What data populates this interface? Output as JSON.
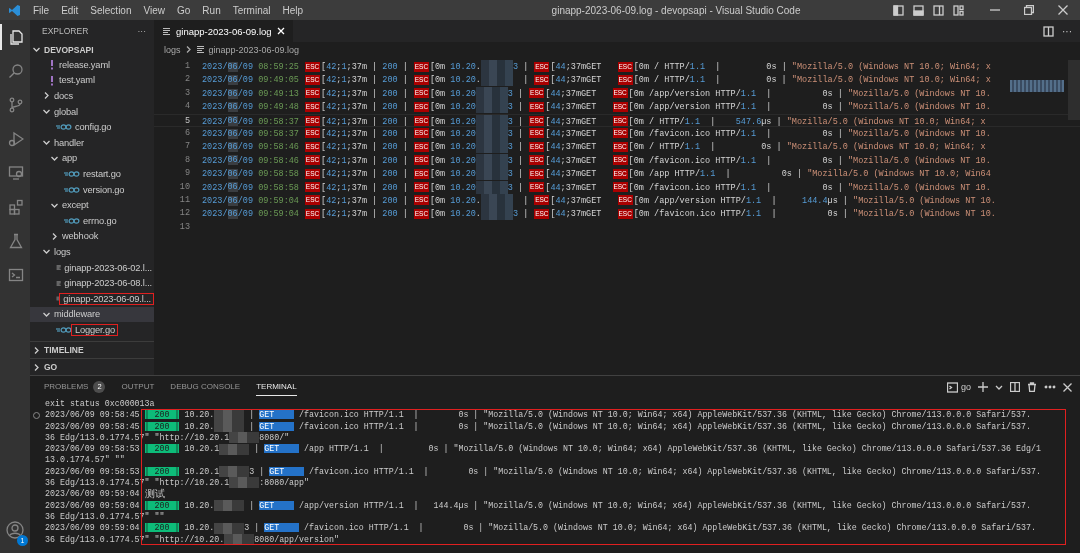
{
  "window": {
    "title": "ginapp-2023-06-09.log - devopsapi - Visual Studio Code"
  },
  "menu": [
    "File",
    "Edit",
    "Selection",
    "View",
    "Go",
    "Run",
    "Terminal",
    "Help"
  ],
  "activity_bar": [
    {
      "kind": "explorer",
      "selected": true
    },
    {
      "kind": "search",
      "selected": false
    },
    {
      "kind": "source-control",
      "selected": false
    },
    {
      "kind": "run",
      "selected": false
    },
    {
      "kind": "remote",
      "selected": false
    },
    {
      "kind": "extensions",
      "selected": false
    },
    {
      "kind": "testing",
      "selected": false
    },
    {
      "kind": "terminal",
      "selected": false
    }
  ],
  "account": {
    "badge": "1"
  },
  "sidebar": {
    "title": "EXPLORER",
    "more": "···",
    "project": {
      "label": "DEVOPSAPI",
      "expanded": true
    },
    "items": [
      {
        "label": "release.yaml",
        "kind": "yaml",
        "selected": false,
        "highlighted": false
      },
      {
        "label": "test.yaml",
        "kind": "yaml",
        "selected": false,
        "highlighted": false
      },
      {
        "label": "docs",
        "kind": "folder",
        "expanded": false,
        "selected": false,
        "highlighted": false
      },
      {
        "label": "global",
        "kind": "folder",
        "expanded": true,
        "selected": false,
        "highlighted": false,
        "children": [
          {
            "label": "config.go",
            "kind": "go",
            "selected": false,
            "highlighted": false
          }
        ]
      },
      {
        "label": "handler",
        "kind": "folder",
        "expanded": true,
        "selected": false,
        "highlighted": false,
        "children": [
          {
            "label": "app",
            "kind": "folder",
            "expanded": true,
            "selected": false,
            "highlighted": false,
            "children": [
              {
                "label": "restart.go",
                "kind": "go",
                "selected": false,
                "highlighted": false
              },
              {
                "label": "version.go",
                "kind": "go",
                "selected": false,
                "highlighted": false
              }
            ]
          },
          {
            "label": "except",
            "kind": "folder",
            "expanded": true,
            "selected": false,
            "highlighted": false,
            "children": [
              {
                "label": "errno.go",
                "kind": "go",
                "selected": false,
                "highlighted": false
              }
            ]
          },
          {
            "label": "webhook",
            "kind": "folder",
            "expanded": false,
            "selected": false,
            "highlighted": false
          }
        ]
      },
      {
        "label": "logs",
        "kind": "folder",
        "expanded": true,
        "selected": false,
        "highlighted": false,
        "children": [
          {
            "label": "ginapp-2023-06-02.l...",
            "kind": "log",
            "selected": false,
            "highlighted": false
          },
          {
            "label": "ginapp-2023-06-08.l...",
            "kind": "log",
            "selected": false,
            "highlighted": false
          },
          {
            "label": "ginapp-2023-06-09.l...",
            "kind": "log",
            "selected": false,
            "highlighted": true
          }
        ]
      },
      {
        "label": "middleware",
        "kind": "folder",
        "expanded": true,
        "selected": true,
        "highlighted": false,
        "children": [
          {
            "label": "Logger.go",
            "kind": "go",
            "selected": false,
            "highlighted": true
          }
        ]
      }
    ],
    "sections": [
      {
        "label": "TIMELINE",
        "expanded": false
      },
      {
        "label": "GO",
        "expanded": false
      }
    ]
  },
  "editor": {
    "tabs": [
      {
        "label": "ginapp-2023-06-09.log",
        "selected": true
      }
    ],
    "breadcrumb": [
      "logs",
      "ginapp-2023-06-09.log"
    ],
    "more": "···",
    "lines": [
      {
        "number": "1",
        "current": false,
        "segments": [
          {
            "kind": "date",
            "text": "2023/"
          },
          {
            "kind": "match",
            "text": "06"
          },
          {
            "kind": "date",
            "text": "/09"
          },
          {
            "kind": "time",
            "text": " 08:59:25 "
          },
          {
            "kind": "esc",
            "text": "ESC"
          },
          {
            "kind": "code",
            "text": "[42;1;37m | 200 | "
          },
          {
            "kind": "esc",
            "text": "ESC"
          },
          {
            "kind": "code",
            "text": "[0m 10.20."
          },
          {
            "kind": "blur"
          },
          {
            "kind": "code",
            "text": "3 | "
          },
          {
            "kind": "esc",
            "text": "ESC"
          },
          {
            "kind": "code",
            "text": "[44;37mGET   "
          },
          {
            "kind": "esc",
            "text": "ESC"
          },
          {
            "kind": "code",
            "text": "[0m / HTTP/1.1  |         0s | \"Mozilla/5.0 (Windows NT 10.0; Win64; x"
          }
        ]
      },
      {
        "number": "2",
        "current": false,
        "segments": [
          {
            "kind": "date",
            "text": "2023/"
          },
          {
            "kind": "match",
            "text": "06"
          },
          {
            "kind": "date",
            "text": "/09"
          },
          {
            "kind": "time",
            "text": " 09:49:05 "
          },
          {
            "kind": "esc",
            "text": "ESC"
          },
          {
            "kind": "code",
            "text": "[42;1;37m | 200 | "
          },
          {
            "kind": "esc",
            "text": "ESC"
          },
          {
            "kind": "code",
            "text": "[0m 10.20."
          },
          {
            "kind": "blur"
          },
          {
            "kind": "code",
            "text": "  | "
          },
          {
            "kind": "esc",
            "text": "ESC"
          },
          {
            "kind": "code",
            "text": "[44;37mGET   "
          },
          {
            "kind": "esc",
            "text": "ESC"
          },
          {
            "kind": "code",
            "text": "[0m / HTTP/1.1  |         0s | \"Mozilla/5.0 (Windows NT 10.0; Win64; x"
          }
        ]
      },
      {
        "number": "3",
        "current": false,
        "segments": [
          {
            "kind": "date",
            "text": "2023/"
          },
          {
            "kind": "match",
            "text": "06"
          },
          {
            "kind": "date",
            "text": "/09"
          },
          {
            "kind": "time",
            "text": " 09:49:13 "
          },
          {
            "kind": "esc",
            "text": "ESC"
          },
          {
            "kind": "code",
            "text": "[42;1;37m | 200 | "
          },
          {
            "kind": "esc",
            "text": "ESC"
          },
          {
            "kind": "code",
            "text": "[0m 10.20"
          },
          {
            "kind": "blur"
          },
          {
            "kind": "code",
            "text": "3 | "
          },
          {
            "kind": "esc",
            "text": "ESC"
          },
          {
            "kind": "code",
            "text": "[44;37mGET   "
          },
          {
            "kind": "esc",
            "text": "ESC"
          },
          {
            "kind": "code",
            "text": "[0m /app/version HTTP/1.1  |          0s | \"Mozilla/5.0 (Windows NT 10."
          }
        ]
      },
      {
        "number": "4",
        "current": false,
        "segments": [
          {
            "kind": "date",
            "text": "2023/"
          },
          {
            "kind": "match",
            "text": "06"
          },
          {
            "kind": "date",
            "text": "/09"
          },
          {
            "kind": "time",
            "text": " 09:49:48 "
          },
          {
            "kind": "esc",
            "text": "ESC"
          },
          {
            "kind": "code",
            "text": "[42;1;37m | 200 | "
          },
          {
            "kind": "esc",
            "text": "ESC"
          },
          {
            "kind": "code",
            "text": "[0m 10.20"
          },
          {
            "kind": "blur"
          },
          {
            "kind": "code",
            "text": "3 | "
          },
          {
            "kind": "esc",
            "text": "ESC"
          },
          {
            "kind": "code",
            "text": "[44;37mGET   "
          },
          {
            "kind": "esc",
            "text": "ESC"
          },
          {
            "kind": "code",
            "text": "[0m /app/version HTTP/1.1  |          0s | \"Mozilla/5.0 (Windows NT 10."
          }
        ]
      },
      {
        "number": "5",
        "current": true,
        "segments": [
          {
            "kind": "date",
            "text": "2023/"
          },
          {
            "kind": "match",
            "text": "06"
          },
          {
            "kind": "date",
            "text": "/09"
          },
          {
            "kind": "time",
            "text": " 09:58:37 "
          },
          {
            "kind": "esc",
            "text": "ESC"
          },
          {
            "kind": "code",
            "text": "[42;1;37m | 200 | "
          },
          {
            "kind": "esc",
            "text": "ESC"
          },
          {
            "kind": "code",
            "text": "[0m 10.20"
          },
          {
            "kind": "blur"
          },
          {
            "kind": "code",
            "text": "3 | "
          },
          {
            "kind": "esc",
            "text": "ESC"
          },
          {
            "kind": "code",
            "text": "[44;37mGET   "
          },
          {
            "kind": "esc",
            "text": "ESC"
          },
          {
            "kind": "code",
            "text": "[0m / HTTP/1.1  |    547.6µs | \"Mozilla/5.0 (Windows NT 10.0; Win64; x"
          }
        ]
      },
      {
        "number": "6",
        "current": false,
        "segments": [
          {
            "kind": "date",
            "text": "2023/"
          },
          {
            "kind": "match",
            "text": "06"
          },
          {
            "kind": "date",
            "text": "/09"
          },
          {
            "kind": "time",
            "text": " 09:58:37 "
          },
          {
            "kind": "esc",
            "text": "ESC"
          },
          {
            "kind": "code",
            "text": "[42;1;37m | 200 | "
          },
          {
            "kind": "esc",
            "text": "ESC"
          },
          {
            "kind": "code",
            "text": "[0m 10.20"
          },
          {
            "kind": "blur"
          },
          {
            "kind": "code",
            "text": "3 | "
          },
          {
            "kind": "esc",
            "text": "ESC"
          },
          {
            "kind": "code",
            "text": "[44;37mGET   "
          },
          {
            "kind": "esc",
            "text": "ESC"
          },
          {
            "kind": "code",
            "text": "[0m /favicon.ico HTTP/1.1  |          0s | \"Mozilla/5.0 (Windows NT 10."
          }
        ]
      },
      {
        "number": "7",
        "current": false,
        "segments": [
          {
            "kind": "date",
            "text": "2023/"
          },
          {
            "kind": "match",
            "text": "06"
          },
          {
            "kind": "date",
            "text": "/09"
          },
          {
            "kind": "time",
            "text": " 09:58:46 "
          },
          {
            "kind": "esc",
            "text": "ESC"
          },
          {
            "kind": "code",
            "text": "[42;1;37m | 200 | "
          },
          {
            "kind": "esc",
            "text": "ESC"
          },
          {
            "kind": "code",
            "text": "[0m 10.20"
          },
          {
            "kind": "blur"
          },
          {
            "kind": "code",
            "text": "3 | "
          },
          {
            "kind": "esc",
            "text": "ESC"
          },
          {
            "kind": "code",
            "text": "[44;37mGET   "
          },
          {
            "kind": "esc",
            "text": "ESC"
          },
          {
            "kind": "code",
            "text": "[0m / HTTP/1.1  |         0s | \"Mozilla/5.0 (Windows NT 10.0; Win64; x"
          }
        ]
      },
      {
        "number": "8",
        "current": false,
        "segments": [
          {
            "kind": "date",
            "text": "2023/"
          },
          {
            "kind": "match",
            "text": "06"
          },
          {
            "kind": "date",
            "text": "/09"
          },
          {
            "kind": "time",
            "text": " 09:58:46 "
          },
          {
            "kind": "esc",
            "text": "ESC"
          },
          {
            "kind": "code",
            "text": "[42;1;37m | 200 | "
          },
          {
            "kind": "esc",
            "text": "ESC"
          },
          {
            "kind": "code",
            "text": "[0m 10.20"
          },
          {
            "kind": "blur"
          },
          {
            "kind": "code",
            "text": "3 | "
          },
          {
            "kind": "esc",
            "text": "ESC"
          },
          {
            "kind": "code",
            "text": "[44;37mGET   "
          },
          {
            "kind": "esc",
            "text": "ESC"
          },
          {
            "kind": "code",
            "text": "[0m /favicon.ico HTTP/1.1  |          0s | \"Mozilla/5.0 (Windows NT 10."
          }
        ]
      },
      {
        "number": "9",
        "current": false,
        "segments": [
          {
            "kind": "date",
            "text": "2023/"
          },
          {
            "kind": "match",
            "text": "06"
          },
          {
            "kind": "date",
            "text": "/09"
          },
          {
            "kind": "time",
            "text": " 09:58:58 "
          },
          {
            "kind": "esc",
            "text": "ESC"
          },
          {
            "kind": "code",
            "text": "[42;1;37m | 200 | "
          },
          {
            "kind": "esc",
            "text": "ESC"
          },
          {
            "kind": "code",
            "text": "[0m 10.20"
          },
          {
            "kind": "blur"
          },
          {
            "kind": "code",
            "text": "3 | "
          },
          {
            "kind": "esc",
            "text": "ESC"
          },
          {
            "kind": "code",
            "text": "[44;37mGET   "
          },
          {
            "kind": "esc",
            "text": "ESC"
          },
          {
            "kind": "code",
            "text": "[0m /app HTTP/1.1  |          0s | \"Mozilla/5.0 (Windows NT 10.0; Win64"
          }
        ]
      },
      {
        "number": "10",
        "current": false,
        "segments": [
          {
            "kind": "date",
            "text": "2023/"
          },
          {
            "kind": "match",
            "text": "06"
          },
          {
            "kind": "date",
            "text": "/09"
          },
          {
            "kind": "time",
            "text": " 09:58:58 "
          },
          {
            "kind": "esc",
            "text": "ESC"
          },
          {
            "kind": "code",
            "text": "[42;1;37m | 200 | "
          },
          {
            "kind": "esc",
            "text": "ESC"
          },
          {
            "kind": "code",
            "text": "[0m 10.20"
          },
          {
            "kind": "blur"
          },
          {
            "kind": "code",
            "text": "3 | "
          },
          {
            "kind": "esc",
            "text": "ESC"
          },
          {
            "kind": "code",
            "text": "[44;37mGET   "
          },
          {
            "kind": "esc",
            "text": "ESC"
          },
          {
            "kind": "code",
            "text": "[0m /favicon.ico HTTP/1.1  |          0s | \"Mozilla/5.0 (Windows NT 10."
          }
        ]
      },
      {
        "number": "11",
        "current": false,
        "segments": [
          {
            "kind": "date",
            "text": "2023/"
          },
          {
            "kind": "match",
            "text": "06"
          },
          {
            "kind": "date",
            "text": "/09"
          },
          {
            "kind": "time",
            "text": " 09:59:04 "
          },
          {
            "kind": "esc",
            "text": "ESC"
          },
          {
            "kind": "code",
            "text": "[42;1;37m | 200 | "
          },
          {
            "kind": "esc",
            "text": "ESC"
          },
          {
            "kind": "code",
            "text": "[0m 10.20."
          },
          {
            "kind": "blur"
          },
          {
            "kind": "code",
            "text": "  | "
          },
          {
            "kind": "esc",
            "text": "ESC"
          },
          {
            "kind": "code",
            "text": "[44;37mGET   "
          },
          {
            "kind": "esc",
            "text": "ESC"
          },
          {
            "kind": "code",
            "text": "[0m /app/version HTTP/1.1  |     144.4µs | \"Mozilla/5.0 (Windows NT 10."
          }
        ]
      },
      {
        "number": "12",
        "current": false,
        "segments": [
          {
            "kind": "date",
            "text": "2023/"
          },
          {
            "kind": "match",
            "text": "06"
          },
          {
            "kind": "date",
            "text": "/09"
          },
          {
            "kind": "time",
            "text": " 09:59:04 "
          },
          {
            "kind": "esc",
            "text": "ESC"
          },
          {
            "kind": "code",
            "text": "[42;1;37m | 200 | "
          },
          {
            "kind": "esc",
            "text": "ESC"
          },
          {
            "kind": "code",
            "text": "[0m 10.20."
          },
          {
            "kind": "blur"
          },
          {
            "kind": "code",
            "text": "3 | "
          },
          {
            "kind": "esc",
            "text": "ESC"
          },
          {
            "kind": "code",
            "text": "[44;37mGET   "
          },
          {
            "kind": "esc",
            "text": "ESC"
          },
          {
            "kind": "code",
            "text": "[0m /favicon.ico HTTP/1.1  |          0s | \"Mozilla/5.0 (Windows NT 10."
          }
        ]
      },
      {
        "number": "13",
        "current": false
      }
    ]
  },
  "panel": {
    "tabs": [
      {
        "label": "PROBLEMS",
        "badge": "2",
        "selected": false
      },
      {
        "label": "OUTPUT",
        "selected": false
      },
      {
        "label": "DEBUG CONSOLE",
        "selected": false
      },
      {
        "label": "TERMINAL",
        "selected": true
      }
    ],
    "terminal_name": "go",
    "highlighted": true,
    "lines": [
      {
        "marker": false,
        "segments": [
          {
            "kind": "text",
            "text": "exit status 0xc000013a"
          }
        ]
      },
      {
        "marker": true,
        "segments": [
          {
            "kind": "text",
            "text": "2023/06/09 09:58:45 "
          },
          {
            "kind": "status",
            "text": "| 200 |"
          },
          {
            "kind": "text",
            "text": " 10.20."
          },
          {
            "kind": "blur"
          },
          {
            "kind": "text",
            "text": " | "
          },
          {
            "kind": "method",
            "text": "GET    "
          },
          {
            "kind": "text",
            "text": " /favicon.ico HTTP/1.1  |        0s | \"Mozilla/5.0 (Windows NT 10.0; Win64; x64) AppleWebKit/537.36 (KHTML, like Gecko) Chrome/113.0.0.0 Safari/537."
          }
        ]
      },
      {
        "marker": false,
        "segments": [
          {
            "kind": "text",
            "text": "2023/06/09 09:58:45 "
          },
          {
            "kind": "status",
            "text": "| 200 |"
          },
          {
            "kind": "text",
            "text": " 10.20."
          },
          {
            "kind": "blur"
          },
          {
            "kind": "text",
            "text": " | "
          },
          {
            "kind": "method",
            "text": "GET    "
          },
          {
            "kind": "text",
            "text": " /favicon.ico HTTP/1.1  |        0s | \"Mozilla/5.0 (Windows NT 10.0; Win64; x64) AppleWebKit/537.36 (KHTML, like Gecko) Chrome/113.0.0.0 Safari/537."
          }
        ]
      },
      {
        "marker": false,
        "segments": [
          {
            "kind": "text",
            "text": "36 Edg/113.0.1774.57\" \"http://10.20.1"
          },
          {
            "kind": "blur"
          },
          {
            "kind": "text",
            "text": "8080/\""
          }
        ]
      },
      {
        "marker": false,
        "segments": [
          {
            "kind": "text",
            "text": "2023/06/09 09:58:53 "
          },
          {
            "kind": "status",
            "text": "| 200 |"
          },
          {
            "kind": "text",
            "text": " 10.20.1"
          },
          {
            "kind": "blur"
          },
          {
            "kind": "text",
            "text": " | "
          },
          {
            "kind": "method",
            "text": "GET    "
          },
          {
            "kind": "text",
            "text": " /app HTTP/1.1  |         0s | \"Mozilla/5.0 (Windows NT 10.0; Win64; x64) AppleWebKit/537.36 (KHTML, like Gecko) Chrome/113.0.0.0 Safari/537.36 Edg/1"
          }
        ]
      },
      {
        "marker": false,
        "segments": [
          {
            "kind": "text",
            "text": "13.0.1774.57\" \"\""
          }
        ]
      },
      {
        "marker": false,
        "segments": [
          {
            "kind": "text",
            "text": "2023/06/09 09:58:53 "
          },
          {
            "kind": "status",
            "text": "| 200 |"
          },
          {
            "kind": "text",
            "text": " 10.20.1"
          },
          {
            "kind": "blur"
          },
          {
            "kind": "text",
            "text": "3 | "
          },
          {
            "kind": "method",
            "text": "GET    "
          },
          {
            "kind": "text",
            "text": " /favicon.ico HTTP/1.1  |        0s | \"Mozilla/5.0 (Windows NT 10.0; Win64; x64) AppleWebKit/537.36 (KHTML, like Gecko) Chrome/113.0.0.0 Safari/537."
          }
        ]
      },
      {
        "marker": false,
        "segments": [
          {
            "kind": "text",
            "text": "36 Edg/113.0.1774.57\" \"http://10.20.1"
          },
          {
            "kind": "blur"
          },
          {
            "kind": "text",
            "text": ":8080/app\""
          }
        ]
      },
      {
        "marker": false,
        "segments": [
          {
            "kind": "text",
            "text": "2023/06/09 09:59:04"
          },
          {
            "kind": "cjk",
            "text": "测试"
          }
        ]
      },
      {
        "marker": false,
        "segments": [
          {
            "kind": "text",
            "text": "2023/06/09 09:59:04 "
          },
          {
            "kind": "status",
            "text": "| 200 |"
          },
          {
            "kind": "text",
            "text": " 10.20."
          },
          {
            "kind": "blur"
          },
          {
            "kind": "text",
            "text": " | "
          },
          {
            "kind": "method",
            "text": "GET    "
          },
          {
            "kind": "text",
            "text": " /app/version HTTP/1.1  |   144.4µs | \"Mozilla/5.0 (Windows NT 10.0; Win64; x64) AppleWebKit/537.36 (KHTML, like Gecko) Chrome/113.0.0.0 Safari/537."
          }
        ]
      },
      {
        "marker": false,
        "segments": [
          {
            "kind": "text",
            "text": "36 Edg/113.0.1774.57\" \"\""
          }
        ]
      },
      {
        "marker": false,
        "segments": [
          {
            "kind": "text",
            "text": "2023/06/09 09:59:04 "
          },
          {
            "kind": "status",
            "text": "| 200 |"
          },
          {
            "kind": "text",
            "text": " 10.20."
          },
          {
            "kind": "blur"
          },
          {
            "kind": "text",
            "text": "3 | "
          },
          {
            "kind": "method",
            "text": "GET    "
          },
          {
            "kind": "text",
            "text": " /favicon.ico HTTP/1.1  |        0s | \"Mozilla/5.0 (Windows NT 10.0; Win64; x64) AppleWebKit/537.36 (KHTML, like Gecko) Chrome/113.0.0.0 Safari/537."
          }
        ]
      },
      {
        "marker": false,
        "segments": [
          {
            "kind": "text",
            "text": "36 Edg/113.0.1774.57\" \"http://10.20."
          },
          {
            "kind": "blur"
          },
          {
            "kind": "text",
            "text": "8080/app/version\""
          }
        ]
      }
    ]
  }
}
